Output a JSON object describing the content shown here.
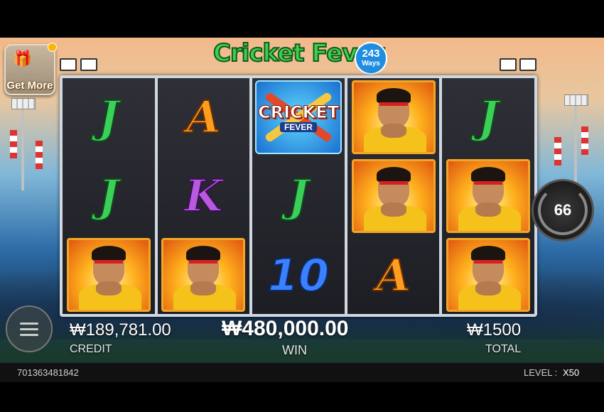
{
  "game": {
    "logo_text": "Cricket Fever",
    "logo_ways_number": "243",
    "logo_ways_text": "Ways",
    "get_more": "Get More",
    "spins_left": "66"
  },
  "reels": [
    [
      {
        "sym": "J"
      },
      {
        "sym": "J"
      },
      {
        "sym": "player"
      }
    ],
    [
      {
        "sym": "A"
      },
      {
        "sym": "K"
      },
      {
        "sym": "player"
      }
    ],
    [
      {
        "sym": "scatter"
      },
      {
        "sym": "J"
      },
      {
        "sym": "10"
      }
    ],
    [
      {
        "sym": "player"
      },
      {
        "sym": "player"
      },
      {
        "sym": "A"
      }
    ],
    [
      {
        "sym": "J"
      },
      {
        "sym": "player"
      },
      {
        "sym": "player"
      }
    ]
  ],
  "scatter": {
    "line1": "CRICKET",
    "line2": "FEVER"
  },
  "stats": {
    "credit_value": "₩189,781.00",
    "credit_label": "CREDIT",
    "win_value": "₩480,000.00",
    "win_label": "WIN",
    "total_value": "₩1500",
    "total_label": "TOTAL"
  },
  "footer": {
    "session_id": "701363481842",
    "level_label": "LEVEL :",
    "level_value": "X50"
  },
  "icons": [
    "gift-icon",
    "menu-icon",
    "autospin-icon",
    "stadium-light-icon"
  ]
}
